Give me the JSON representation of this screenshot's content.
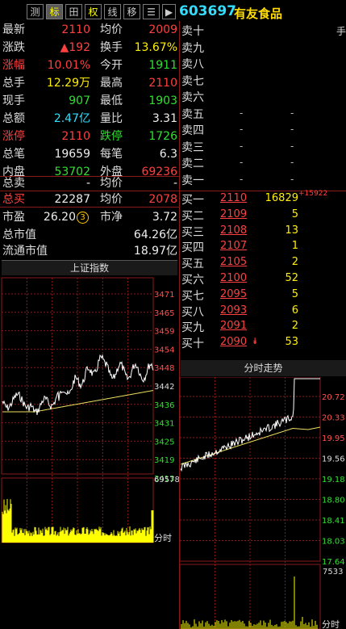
{
  "toolbar": {
    "buttons": [
      "测",
      "标",
      "田",
      "权",
      "线",
      "移",
      "☰",
      "▶"
    ],
    "code": "603697",
    "name": "有友食品",
    "corner": "手"
  },
  "quote": {
    "latest_label": "最新",
    "latest": "2110",
    "avg_label": "均价",
    "avg": "2009",
    "change_label": "涨跌",
    "change": "▲192",
    "turnover_label": "换手",
    "turnover": "13.67%",
    "pct_label": "涨幅",
    "pct": "10.01%",
    "open_label": "今开",
    "open": "1911",
    "volume_label": "总手",
    "volume": "12.29万",
    "high_label": "最高",
    "high": "2110",
    "cur_label": "现手",
    "cur": "907",
    "low_label": "最低",
    "low": "1903",
    "amount_label": "总额",
    "amount": "2.47亿",
    "ratio_label": "量比",
    "ratio": "3.31",
    "limitup_label": "涨停",
    "limitup": "2110",
    "limitdown_label": "跌停",
    "limitdown": "1726",
    "trades_label": "总笔",
    "trades": "19659",
    "pertrade_label": "每笔",
    "pertrade": "6.3",
    "inner_label": "内盘",
    "inner": "53702",
    "outer_label": "外盘",
    "outer": "69236",
    "totalsell_label": "总卖",
    "totalsell": "-",
    "avg2_label": "均价",
    "avg2": "-",
    "totalbuy_label": "总买",
    "totalbuy": "22287",
    "avg3_label": "均价",
    "avg3": "2078",
    "pe_label": "市盈",
    "pe": "26.20",
    "pe_badge": "3",
    "pb_label": "市净",
    "pb": "3.72",
    "mktcap_label": "总市值",
    "mktcap": "64.26亿",
    "float_label": "流通市值",
    "float": "18.97亿"
  },
  "sell_orders": [
    {
      "label": "卖十",
      "price": "",
      "vol": ""
    },
    {
      "label": "卖九",
      "price": "",
      "vol": ""
    },
    {
      "label": "卖八",
      "price": "",
      "vol": ""
    },
    {
      "label": "卖七",
      "price": "",
      "vol": ""
    },
    {
      "label": "卖六",
      "price": "",
      "vol": ""
    },
    {
      "label": "卖五",
      "price": "-",
      "vol": "-"
    },
    {
      "label": "卖四",
      "price": "-",
      "vol": "-"
    },
    {
      "label": "卖三",
      "price": "-",
      "vol": "-"
    },
    {
      "label": "卖二",
      "price": "-",
      "vol": "-"
    },
    {
      "label": "卖一",
      "price": "-",
      "vol": "-"
    }
  ],
  "buy_orders": [
    {
      "label": "买一",
      "price": "2110",
      "vol": "16829",
      "extra": "+15922"
    },
    {
      "label": "买二",
      "price": "2109",
      "vol": "5"
    },
    {
      "label": "买三",
      "price": "2108",
      "vol": "13"
    },
    {
      "label": "买四",
      "price": "2107",
      "vol": "1"
    },
    {
      "label": "买五",
      "price": "2105",
      "vol": "2"
    },
    {
      "label": "买六",
      "price": "2100",
      "vol": "52"
    },
    {
      "label": "买七",
      "price": "2095",
      "vol": "5"
    },
    {
      "label": "买八",
      "price": "2093",
      "vol": "6"
    },
    {
      "label": "买九",
      "price": "2091",
      "vol": "2"
    },
    {
      "label": "买十",
      "price": "2090",
      "vol": "53",
      "mark": "⯯"
    }
  ],
  "index_chart": {
    "title": "上证指数",
    "y_ticks": [
      "3471",
      "3465",
      "3459",
      "3454",
      "3448",
      "3442",
      "3436",
      "3431",
      "3425",
      "3419",
      "3413"
    ],
    "vol_max": "69578",
    "vol_label": "分时"
  },
  "stock_chart": {
    "title": "分时走势",
    "y_ticks": [
      "20.72",
      "20.33",
      "19.95",
      "19.56",
      "19.18",
      "18.80",
      "18.41",
      "18.03",
      "17.64"
    ],
    "vol_max": "7533",
    "vol_label": "分时"
  },
  "colors": {
    "up": "#ff4040",
    "down": "#30e030",
    "avg_line": "#f0e060",
    "price_line": "#ffffff",
    "volume": "#ffff00",
    "grid": "#8a1a1a"
  }
}
